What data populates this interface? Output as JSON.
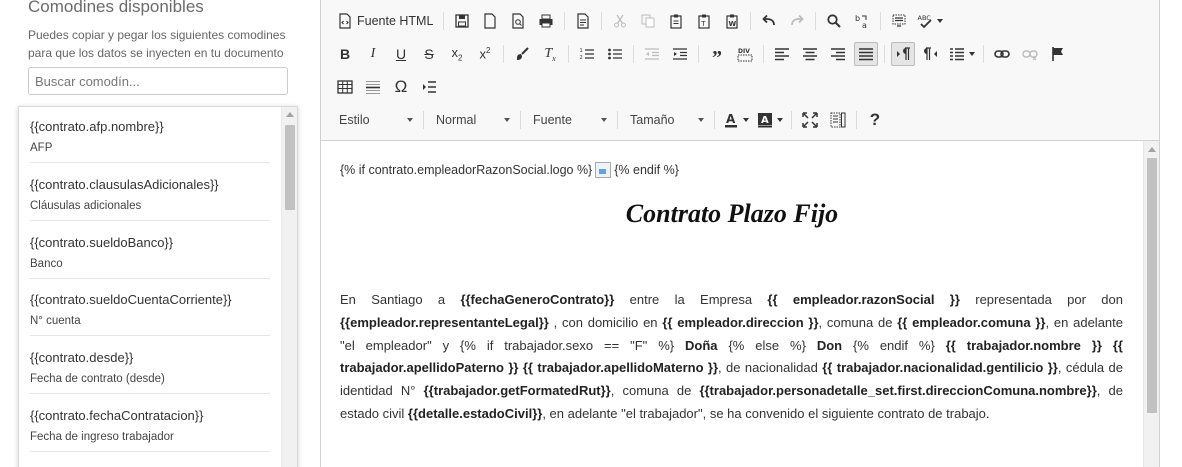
{
  "panel": {
    "title": "Comodines disponibles",
    "help": "Puedes copiar y pegar los siguientes comodines para que los datos se inyecten en tu documento",
    "search_placeholder": "Buscar comodín...",
    "wildcards": [
      {
        "code": "{{contrato.afp.nombre}}",
        "label": "AFP"
      },
      {
        "code": "{{contrato.clausulasAdicionales}}",
        "label": "Cláusulas adicionales"
      },
      {
        "code": "{{contrato.sueldoBanco}}",
        "label": "Banco"
      },
      {
        "code": "{{contrato.sueldoCuentaCorriente}}",
        "label": "N° cuenta"
      },
      {
        "code": "{{contrato.desde}}",
        "label": "Fecha de contrato (desde)"
      },
      {
        "code": "{{contrato.fechaContratacion}}",
        "label": "Fecha de ingreso trabajador"
      }
    ]
  },
  "toolbar": {
    "source_label": "Fuente HTML",
    "combos": {
      "styles": "Estilo",
      "format": "Normal",
      "font": "Fuente",
      "size": "Tamaño"
    }
  },
  "document": {
    "line1_before": "{% if contrato.empleadorRazonSocial.logo %}",
    "line1_after": "{% endif %}",
    "title": "Contrato Plazo Fijo",
    "paragraph": [
      {
        "t": "En Santiago a "
      },
      {
        "t": "{{fechaGeneroContrato}}",
        "b": true
      },
      {
        "t": " entre la Empresa "
      },
      {
        "t": "{{ empleador.razonSocial }}",
        "b": true
      },
      {
        "t": " representada por don "
      },
      {
        "t": "{{empleador.representanteLegal}}",
        "b": true
      },
      {
        "t": " , con domicilio en "
      },
      {
        "t": "{{ empleador.direccion }}",
        "b": true
      },
      {
        "t": ", comuna de "
      },
      {
        "t": "{{ empleador.comuna }}",
        "b": true
      },
      {
        "t": ", en adelante \"el empleador\" y {% if trabajador.sexo == \"F\" %} "
      },
      {
        "t": "Doña",
        "b": true
      },
      {
        "t": " {% else %} "
      },
      {
        "t": "Don",
        "b": true
      },
      {
        "t": " {% endif %} "
      },
      {
        "t": "{{ trabajador.nombre }} {{ trabajador.apellidoPaterno }} {{ trabajador.apellidoMaterno }}",
        "b": true
      },
      {
        "t": ", de nacionalidad "
      },
      {
        "t": "{{ trabajador.nacionalidad.gentilicio }}",
        "b": true
      },
      {
        "t": ", cédula de identidad N° "
      },
      {
        "t": "{{trabajador.getFormatedRut}}",
        "b": true
      },
      {
        "t": ", comuna de "
      },
      {
        "t": "{{trabajador.personadetalle_set.first.direccionComuna.nombre}}",
        "b": true
      },
      {
        "t": ", de estado civil "
      },
      {
        "t": "{{detalle.estadoCivil}}",
        "b": true
      },
      {
        "t": ", en adelante \"el trabajador\", se ha convenido el siguiente contrato de trabajo."
      }
    ]
  }
}
